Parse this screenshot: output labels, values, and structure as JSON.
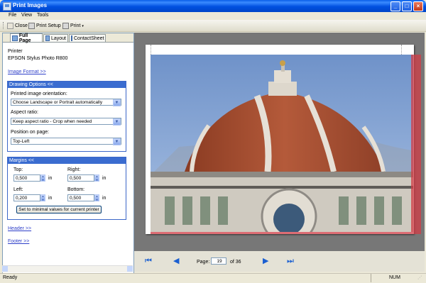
{
  "window": {
    "title": "Print Images"
  },
  "menu": [
    "File",
    "View",
    "Tools"
  ],
  "toolbar": {
    "close": "Close",
    "print_setup": "Print Setup",
    "print": "Print"
  },
  "tabs": [
    "Full Page",
    "Layout",
    "ContactSheet"
  ],
  "printer": {
    "label": "Printer",
    "name": "EPSON Stylus Photo R800"
  },
  "links": {
    "image_format": "Image Format >>",
    "header": "Header >>",
    "footer": "Footer >>"
  },
  "drawing_options": {
    "title": "Drawing Options <<",
    "orientation_label": "Printed image orientation:",
    "orientation_value": "Choose Landscape or Portrait automatically",
    "aspect_label": "Aspect ratio:",
    "aspect_value": "Keep aspect ratio - Crop when needed",
    "position_label": "Position on page:",
    "position_value": "Top-Left"
  },
  "margins": {
    "title": "Margins <<",
    "top_label": "Top:",
    "top_value": "0,500",
    "right_label": "Right:",
    "right_value": "0,500",
    "left_label": "Left:",
    "left_value": "0,200",
    "bottom_label": "Bottom:",
    "bottom_value": "0,500",
    "unit": "in",
    "minimal_button": "Set to minimal values for current printer"
  },
  "nav": {
    "page_label": "Page:",
    "page_value": "19",
    "of_label": "of 36"
  },
  "status": {
    "left": "Ready",
    "num": "NUM"
  },
  "colors": {
    "titlebar": "#0a5ee8",
    "panel_header": "#3a6cd0",
    "link": "#2e3fc9",
    "preview_bg": "#777777",
    "nav_arrow": "#1a5fd1"
  }
}
